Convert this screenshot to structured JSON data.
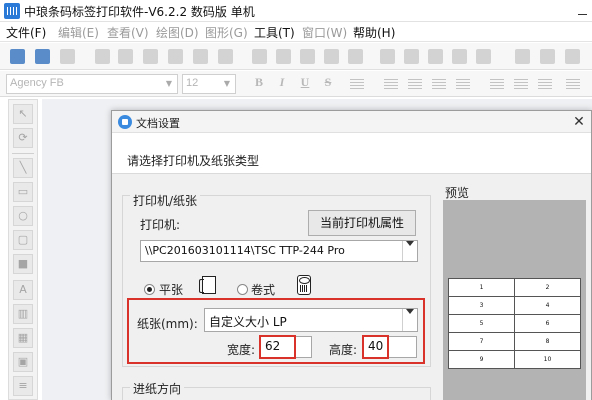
{
  "app": {
    "title": "中琅条码标签打印软件-V6.2.2 数码版 单机"
  },
  "menu": {
    "items": [
      {
        "label": "文件(F)",
        "enabled": true
      },
      {
        "label": "编辑(E)",
        "enabled": false
      },
      {
        "label": "查看(V)",
        "enabled": false
      },
      {
        "label": "绘图(D)",
        "enabled": false
      },
      {
        "label": "图形(G)",
        "enabled": false
      },
      {
        "label": "工具(T)",
        "enabled": true
      },
      {
        "label": "窗口(W)",
        "enabled": false
      },
      {
        "label": "帮助(H)",
        "enabled": true
      }
    ]
  },
  "font_toolbar": {
    "font_name": "Agency FB",
    "font_size": "12"
  },
  "dialog": {
    "title": "文档设置",
    "close_glyph": "✕",
    "prompt": "请选择打印机及纸张类型",
    "printer_group_title": "打印机/纸张",
    "printer_label": "打印机:",
    "printer_props_button": "当前打印机属性",
    "printer_value": "\\\\PC201603101114\\TSC TTP-244 Pro",
    "sheet_label": "平张",
    "sheet_checked": true,
    "roll_label": "卷式",
    "roll_checked": false,
    "paper_label": "纸张(mm):",
    "paper_value": "自定义大小 LP",
    "width_label": "宽度:",
    "width_value": "62",
    "height_label": "高度:",
    "height_value": "40",
    "feed_group_title": "进纸方向",
    "preview_title": "预览",
    "preview_grid": [
      [
        "1",
        "2"
      ],
      [
        "3",
        "4"
      ],
      [
        "5",
        "6"
      ],
      [
        "7",
        "8"
      ],
      [
        "9",
        "10"
      ]
    ]
  },
  "colors": {
    "highlight_red": "#d9322b",
    "accent_blue": "#3a8be0"
  }
}
